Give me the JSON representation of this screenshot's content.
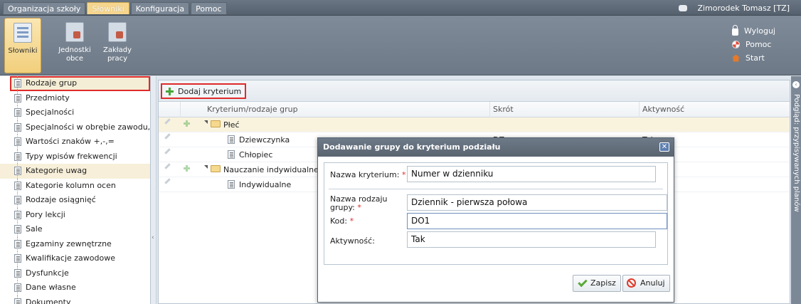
{
  "topmenu": {
    "items": [
      "Organizacja szkoły",
      "Słowniki",
      "Konfiguracja",
      "Pomoc"
    ],
    "active_index": 1,
    "user": "Zimorodek Tomasz [TZ]"
  },
  "ribbon": {
    "buttons": [
      {
        "label": "Słowniki",
        "icon": "dictionary-icon"
      },
      {
        "label": "Jednostki obce",
        "icon": "external-units-icon"
      },
      {
        "label": "Zakłady pracy",
        "icon": "workplaces-icon"
      }
    ],
    "links": [
      {
        "label": "Wyloguj",
        "icon": "lock-icon"
      },
      {
        "label": "Pomoc",
        "icon": "help-icon"
      },
      {
        "label": "Start",
        "icon": "home-icon"
      }
    ]
  },
  "sidebar": {
    "items": [
      "Rodzaje grup",
      "Przedmioty",
      "Specjalności",
      "Specjalności w obrębie zawodu, s",
      "Wartości znaków +,-,=",
      "Typy wpisów frekwencji",
      "Kategorie uwag",
      "Kategorie kolumn ocen",
      "Rodzaje osiągnięć",
      "Pory lekcji",
      "Sale",
      "Egzaminy zewnętrzne",
      "Kwalifikacje zawodowe",
      "Dysfunkcje",
      "Dane własne",
      "Dokumenty"
    ],
    "selected_index": 0,
    "highlighted_index": 6
  },
  "toolbar": {
    "add_label": "Dodaj kryterium"
  },
  "grid": {
    "headers": [
      "Kryterium/rodzaje grup",
      "Skrót",
      "Aktywność"
    ],
    "rows": [
      {
        "name": "Płeć",
        "type": "criterion",
        "short": "",
        "active": ""
      },
      {
        "name": "Dziewczynka",
        "type": "group",
        "short": "DZ",
        "active": "Tak"
      },
      {
        "name": "Chłopiec",
        "type": "group",
        "short": "",
        "active": ""
      },
      {
        "name": "Nauczanie indywidualne",
        "type": "criterion",
        "short": "",
        "active": ""
      },
      {
        "name": "Indywidualne",
        "type": "group",
        "short": "",
        "active": ""
      }
    ]
  },
  "right_panel": {
    "label": "Podgląd: przypisywanych planów"
  },
  "dialog": {
    "title": "Dodawanie grupy do kryterium podziału",
    "fields": {
      "criterion_label": "Nazwa kryterium:",
      "criterion_value": "Numer w dzienniku",
      "group_label": "Nazwa rodzaju grupy:",
      "group_value": "Dziennik - pierwsza połowa",
      "code_label": "Kod:",
      "code_value": "DO1",
      "active_label": "Aktywność:",
      "active_value": "Tak"
    },
    "save_label": "Zapisz",
    "cancel_label": "Anuluj"
  }
}
